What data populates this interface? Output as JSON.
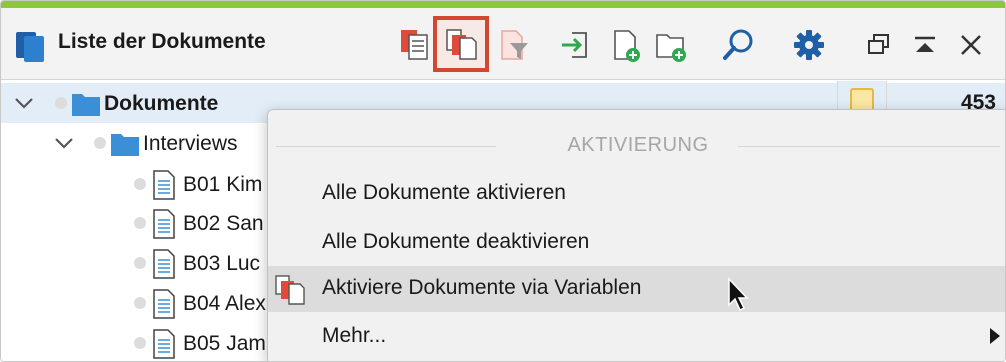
{
  "window": {
    "title": "Liste der Dokumente"
  },
  "toolbar": {
    "buttons": [
      {
        "name": "Dokumentenliste",
        "icon": "document-list-icon"
      },
      {
        "name": "Aktivierung",
        "icon": "activate-documents-icon",
        "active": true
      },
      {
        "name": "Filter",
        "icon": "filter-icon"
      },
      {
        "name": "Import",
        "icon": "import-icon"
      },
      {
        "name": "Neues Dokument",
        "icon": "new-document-icon"
      },
      {
        "name": "Neue Dokumentgruppe",
        "icon": "new-folder-icon"
      },
      {
        "name": "Suchen",
        "icon": "search-icon"
      },
      {
        "name": "Einstellungen",
        "icon": "gear-icon"
      },
      {
        "name": "Abdocken",
        "icon": "undock-icon"
      },
      {
        "name": "Minimieren",
        "icon": "collapse-icon"
      },
      {
        "name": "Schließen",
        "icon": "close-icon"
      }
    ]
  },
  "tree": {
    "root": {
      "label": "Dokumente",
      "count": "453"
    },
    "group": {
      "label": "Interviews"
    },
    "documents": [
      "B01 Kim",
      "B02 San",
      "B03 Luc",
      "B04 Alex",
      "B05 Jam"
    ]
  },
  "context_menu": {
    "header": "AKTIVIERUNG",
    "items": [
      {
        "label": "Alle Dokumente aktivieren"
      },
      {
        "label": "Alle Dokumente deaktivieren"
      },
      {
        "label": "Aktiviere Dokumente via Variablen",
        "icon": "activate-via-variables-icon",
        "highlighted": true
      },
      {
        "label": "Mehr...",
        "has_submenu": true
      }
    ]
  },
  "colors": {
    "accent_green": "#8cc63e",
    "active_outline": "#d2472f",
    "selection": "#e3edf7",
    "folder_blue": "#3a8fd6"
  }
}
